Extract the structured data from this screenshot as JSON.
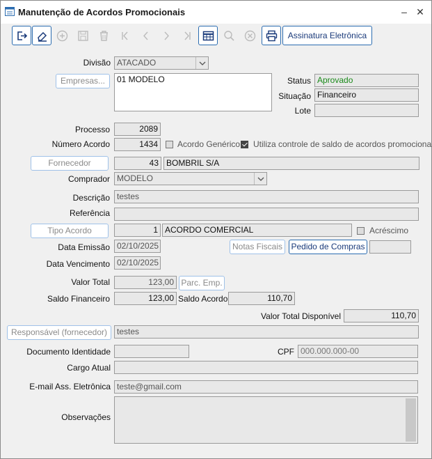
{
  "window": {
    "title": "Manutenção de Acordos Promocionais",
    "minimize": "–",
    "close": "✕"
  },
  "toolbar": {
    "signature_button": "Assinatura Eletrônica"
  },
  "labels": {
    "divisao": "Divisão",
    "status": "Status",
    "situacao": "Situação",
    "lote": "Lote",
    "processo": "Processo",
    "numero_acordo": "Número Acordo",
    "acordo_generico": "Acordo Genérico",
    "utiliza_controle": "Utiliza controle de saldo de acordos promocionais",
    "comprador": "Comprador",
    "descricao": "Descrição",
    "referencia": "Referência",
    "acrescimo": "Acréscimo",
    "data_emissao": "Data Emissão",
    "data_vencimento": "Data Vencimento",
    "valor_total": "Valor Total",
    "saldo_financeiro": "Saldo Financeiro",
    "saldo_acordo": "Saldo Acordo",
    "valor_total_disponivel": "Valor Total Disponível",
    "documento_identidade": "Documento Identidade",
    "cpf": "CPF",
    "cargo_atual": "Cargo Atual",
    "email_ass": "E-mail Ass. Eletrônica",
    "observacoes": "Observações"
  },
  "buttons": {
    "empresas": "Empresas...",
    "fornecedor": "Fornecedor",
    "tipo_acordo": "Tipo Acordo",
    "notas_fiscais": "Notas Fiscais",
    "pedido_compras": "Pedido de Compras",
    "parc_emp": "Parc. Emp.",
    "responsavel": "Responsável (fornecedor)"
  },
  "values": {
    "divisao": "ATACADO",
    "empresas": "01 MODELO",
    "status": "Aprovado",
    "situacao": "Financeiro",
    "lote": "",
    "processo": "2089",
    "numero_acordo": "1434",
    "acordo_generico_checked": false,
    "utiliza_controle_checked": true,
    "fornecedor_codigo": "43",
    "fornecedor_nome": "BOMBRIL S/A",
    "comprador": "MODELO",
    "descricao": "testes",
    "referencia": "",
    "tipo_acordo_codigo": "1",
    "tipo_acordo_nome": "ACORDO COMERCIAL",
    "acrescimo_checked": false,
    "data_emissao": "02/10/2025",
    "data_vencimento": "02/10/2025",
    "pedido_compras": "",
    "valor_total": "123,00",
    "saldo_financeiro": "123,00",
    "saldo_acordo": "110,70",
    "valor_total_disponivel": "110,70",
    "responsavel": "testes",
    "documento_identidade": "",
    "cpf_placeholder": "000.000.000-00",
    "cargo_atual": "",
    "email": "teste@gmail.com",
    "observacoes": ""
  },
  "colors": {
    "status_text": "#1a8a1a",
    "accent": "#2b6cb0"
  }
}
